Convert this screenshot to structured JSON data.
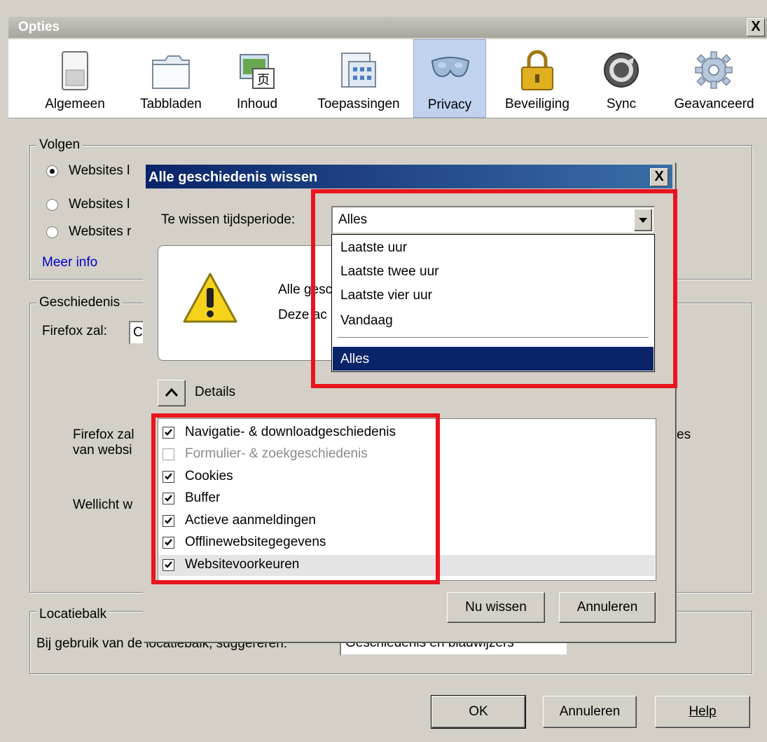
{
  "window": {
    "title": "Opties",
    "close_label": "X"
  },
  "toolbar": {
    "items": [
      {
        "label": "Algemeen",
        "icon": "switch-icon"
      },
      {
        "label": "Tabbladen",
        "icon": "tabs-icon"
      },
      {
        "label": "Inhoud",
        "icon": "content-icon"
      },
      {
        "label": "Toepassingen",
        "icon": "applications-icon"
      },
      {
        "label": "Privacy",
        "icon": "mask-icon",
        "selected": true
      },
      {
        "label": "Beveiliging",
        "icon": "lock-icon"
      },
      {
        "label": "Sync",
        "icon": "sync-icon"
      },
      {
        "label": "Geavanceerd",
        "icon": "gear-icon"
      }
    ]
  },
  "tracking": {
    "group_label": "Volgen",
    "options": [
      "Websites l",
      "Websites l",
      "Websites r"
    ],
    "selected_index": 0,
    "more_info": "Meer info"
  },
  "history": {
    "group_label": "Geschiedenis",
    "firefox_will_label": "Firefox zal:",
    "combo_value": "C",
    "desc_line1": "Firefox zal",
    "desc_line2": "van websi",
    "desc_tail": "es",
    "maybe": "Wellicht w"
  },
  "locationbar": {
    "group_label": "Locatiebalk",
    "label": "Bij gebruik van de locatiebalk, suggereren:",
    "combo_value": "Geschiedenis en bladwijzers"
  },
  "footer": {
    "ok": "OK",
    "cancel": "Annuleren",
    "help": "Help"
  },
  "dialog": {
    "title": "Alle geschiedenis wissen",
    "close_label": "X",
    "period_label": "Te wissen tijdsperiode:",
    "period_value": "Alles",
    "period_options": [
      "Laatste uur",
      "Laatste twee uur",
      "Laatste vier uur",
      "Vandaag",
      "Alles"
    ],
    "period_selected": "Alles",
    "warning_line1": "Alle gesc",
    "warning_line2": "Deze ac",
    "details_label": "Details",
    "items": [
      {
        "label": "Navigatie- & downloadgeschiedenis",
        "checked": true,
        "enabled": true
      },
      {
        "label": "Formulier- & zoekgeschiedenis",
        "checked": false,
        "enabled": false
      },
      {
        "label": "Cookies",
        "checked": true,
        "enabled": true
      },
      {
        "label": "Buffer",
        "checked": true,
        "enabled": true
      },
      {
        "label": "Actieve aanmeldingen",
        "checked": true,
        "enabled": true
      },
      {
        "label": "Offlinewebsitegegevens",
        "checked": true,
        "enabled": true
      },
      {
        "label": "Websitevoorkeuren",
        "checked": true,
        "enabled": true
      }
    ],
    "clear_now": "Nu wissen",
    "cancel": "Annuleren"
  },
  "colors": {
    "highlight": "#e8141e",
    "selection": "#0a246a",
    "dialog_title_start": "#0a246a",
    "dialog_title_end": "#3a6ea5"
  }
}
